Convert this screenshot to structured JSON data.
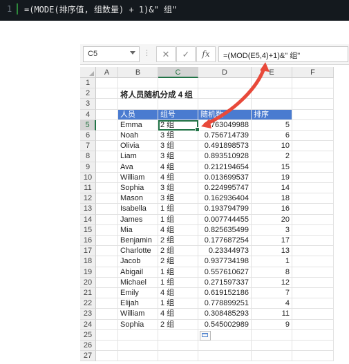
{
  "code_line": {
    "number": "1",
    "text": "=(MODE(排序值, 组数量) + 1)&\" 组\""
  },
  "excel": {
    "name_box": "C5",
    "formula": "=(MOD(E5,4)+1)&\" 组\"",
    "fx_label": "fx",
    "cancel_label": "✕",
    "enter_label": "✓",
    "columns": [
      "A",
      "B",
      "C",
      "D",
      "E",
      "F"
    ],
    "row_numbers": [
      "1",
      "2",
      "3",
      "4",
      "5",
      "6",
      "7",
      "8",
      "9",
      "10",
      "11",
      "12",
      "13",
      "14",
      "15",
      "16",
      "17",
      "18",
      "19",
      "20",
      "21",
      "22",
      "23",
      "24",
      "25",
      "26",
      "27"
    ],
    "title": "将人员随机分成 4 组",
    "headers": [
      "人员",
      "组号",
      "随机数",
      "排序"
    ],
    "rows": [
      [
        "Emma",
        "2 组",
        "0.763049988",
        "5"
      ],
      [
        "Noah",
        "3 组",
        "0.756714739",
        "6"
      ],
      [
        "Olivia",
        "3 组",
        "0.491898573",
        "10"
      ],
      [
        "Liam",
        "3 组",
        "0.893510928",
        "2"
      ],
      [
        "Ava",
        "4 组",
        "0.212194654",
        "15"
      ],
      [
        "William",
        "4 组",
        "0.013699537",
        "19"
      ],
      [
        "Sophia",
        "3 组",
        "0.224995747",
        "14"
      ],
      [
        "Mason",
        "3 组",
        "0.162936404",
        "18"
      ],
      [
        "Isabella",
        "1 组",
        "0.193794799",
        "16"
      ],
      [
        "James",
        "1 组",
        "0.007744455",
        "20"
      ],
      [
        "Mia",
        "4 组",
        "0.825635499",
        "3"
      ],
      [
        "Benjamin",
        "2 组",
        "0.177687254",
        "17"
      ],
      [
        "Charlotte",
        "2 组",
        "0.23344973",
        "13"
      ],
      [
        "Jacob",
        "2 组",
        "0.937734198",
        "1"
      ],
      [
        "Abigail",
        "1 组",
        "0.557610627",
        "8"
      ],
      [
        "Michael",
        "1 组",
        "0.271597337",
        "12"
      ],
      [
        "Emily",
        "4 组",
        "0.619152186",
        "7"
      ],
      [
        "Elijah",
        "1 组",
        "0.778899251",
        "4"
      ],
      [
        "William",
        "4 组",
        "0.308485293",
        "11"
      ],
      [
        "Sophia",
        "2 组",
        "0.545002989",
        "9"
      ]
    ],
    "colors": {
      "header_fill": "#4a7bd0",
      "selection": "#217346",
      "arrow": "#e8493a"
    }
  }
}
